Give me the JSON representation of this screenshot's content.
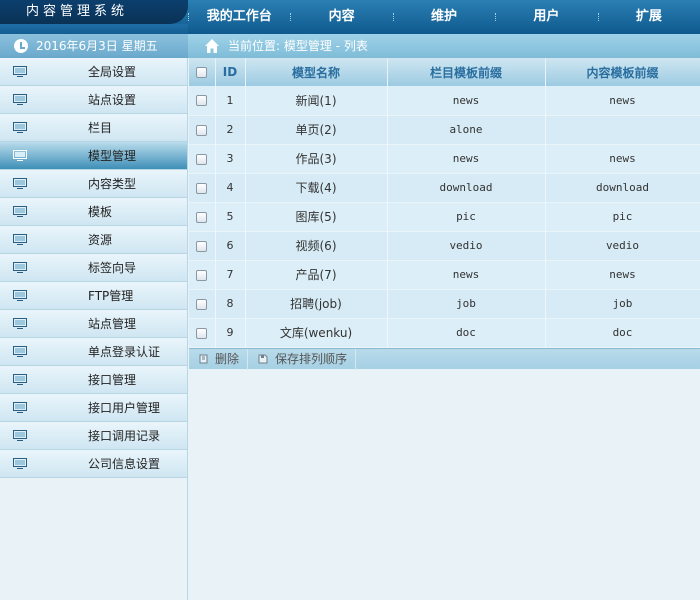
{
  "app": {
    "title": "内容管理系统"
  },
  "nav": [
    {
      "label": "我的工作台"
    },
    {
      "label": "内容"
    },
    {
      "label": "维护"
    },
    {
      "label": "用户"
    },
    {
      "label": "扩展"
    }
  ],
  "date": "2016年6月3日 星期五",
  "location": "当前位置: 模型管理 - 列表",
  "sidebar": {
    "items": [
      {
        "label": "全局设置",
        "active": false
      },
      {
        "label": "站点设置",
        "active": false
      },
      {
        "label": "栏目",
        "active": false
      },
      {
        "label": "模型管理",
        "active": true
      },
      {
        "label": "内容类型",
        "active": false
      },
      {
        "label": "模板",
        "active": false
      },
      {
        "label": "资源",
        "active": false
      },
      {
        "label": "标签向导",
        "active": false
      },
      {
        "label": "FTP管理",
        "active": false
      },
      {
        "label": "站点管理",
        "active": false
      },
      {
        "label": "单点登录认证",
        "active": false
      },
      {
        "label": "接口管理",
        "active": false
      },
      {
        "label": "接口用户管理",
        "active": false
      },
      {
        "label": "接口调用记录",
        "active": false
      },
      {
        "label": "公司信息设置",
        "active": false
      }
    ]
  },
  "table": {
    "headers": {
      "id": "ID",
      "name": "模型名称",
      "channel_prefix": "栏目模板前缀",
      "content_prefix": "内容模板前缀"
    },
    "rows": [
      {
        "id": "1",
        "name": "新闻(1)",
        "channel_prefix": "news",
        "content_prefix": "news"
      },
      {
        "id": "2",
        "name": "单页(2)",
        "channel_prefix": "alone",
        "content_prefix": ""
      },
      {
        "id": "3",
        "name": "作品(3)",
        "channel_prefix": "news",
        "content_prefix": "news"
      },
      {
        "id": "4",
        "name": "下载(4)",
        "channel_prefix": "download",
        "content_prefix": "download"
      },
      {
        "id": "5",
        "name": "图库(5)",
        "channel_prefix": "pic",
        "content_prefix": "pic"
      },
      {
        "id": "6",
        "name": "视频(6)",
        "channel_prefix": "vedio",
        "content_prefix": "vedio"
      },
      {
        "id": "7",
        "name": "产品(7)",
        "channel_prefix": "news",
        "content_prefix": "news"
      },
      {
        "id": "8",
        "name": "招聘(job)",
        "channel_prefix": "job",
        "content_prefix": "job"
      },
      {
        "id": "9",
        "name": "文库(wenku)",
        "channel_prefix": "doc",
        "content_prefix": "doc"
      }
    ]
  },
  "actions": {
    "delete": "删除",
    "save_order": "保存排列顺序"
  },
  "colors": {
    "topbar": "#0f5a8f",
    "header_text": "#2a6e9f",
    "active_item": "#3f8fb7"
  }
}
